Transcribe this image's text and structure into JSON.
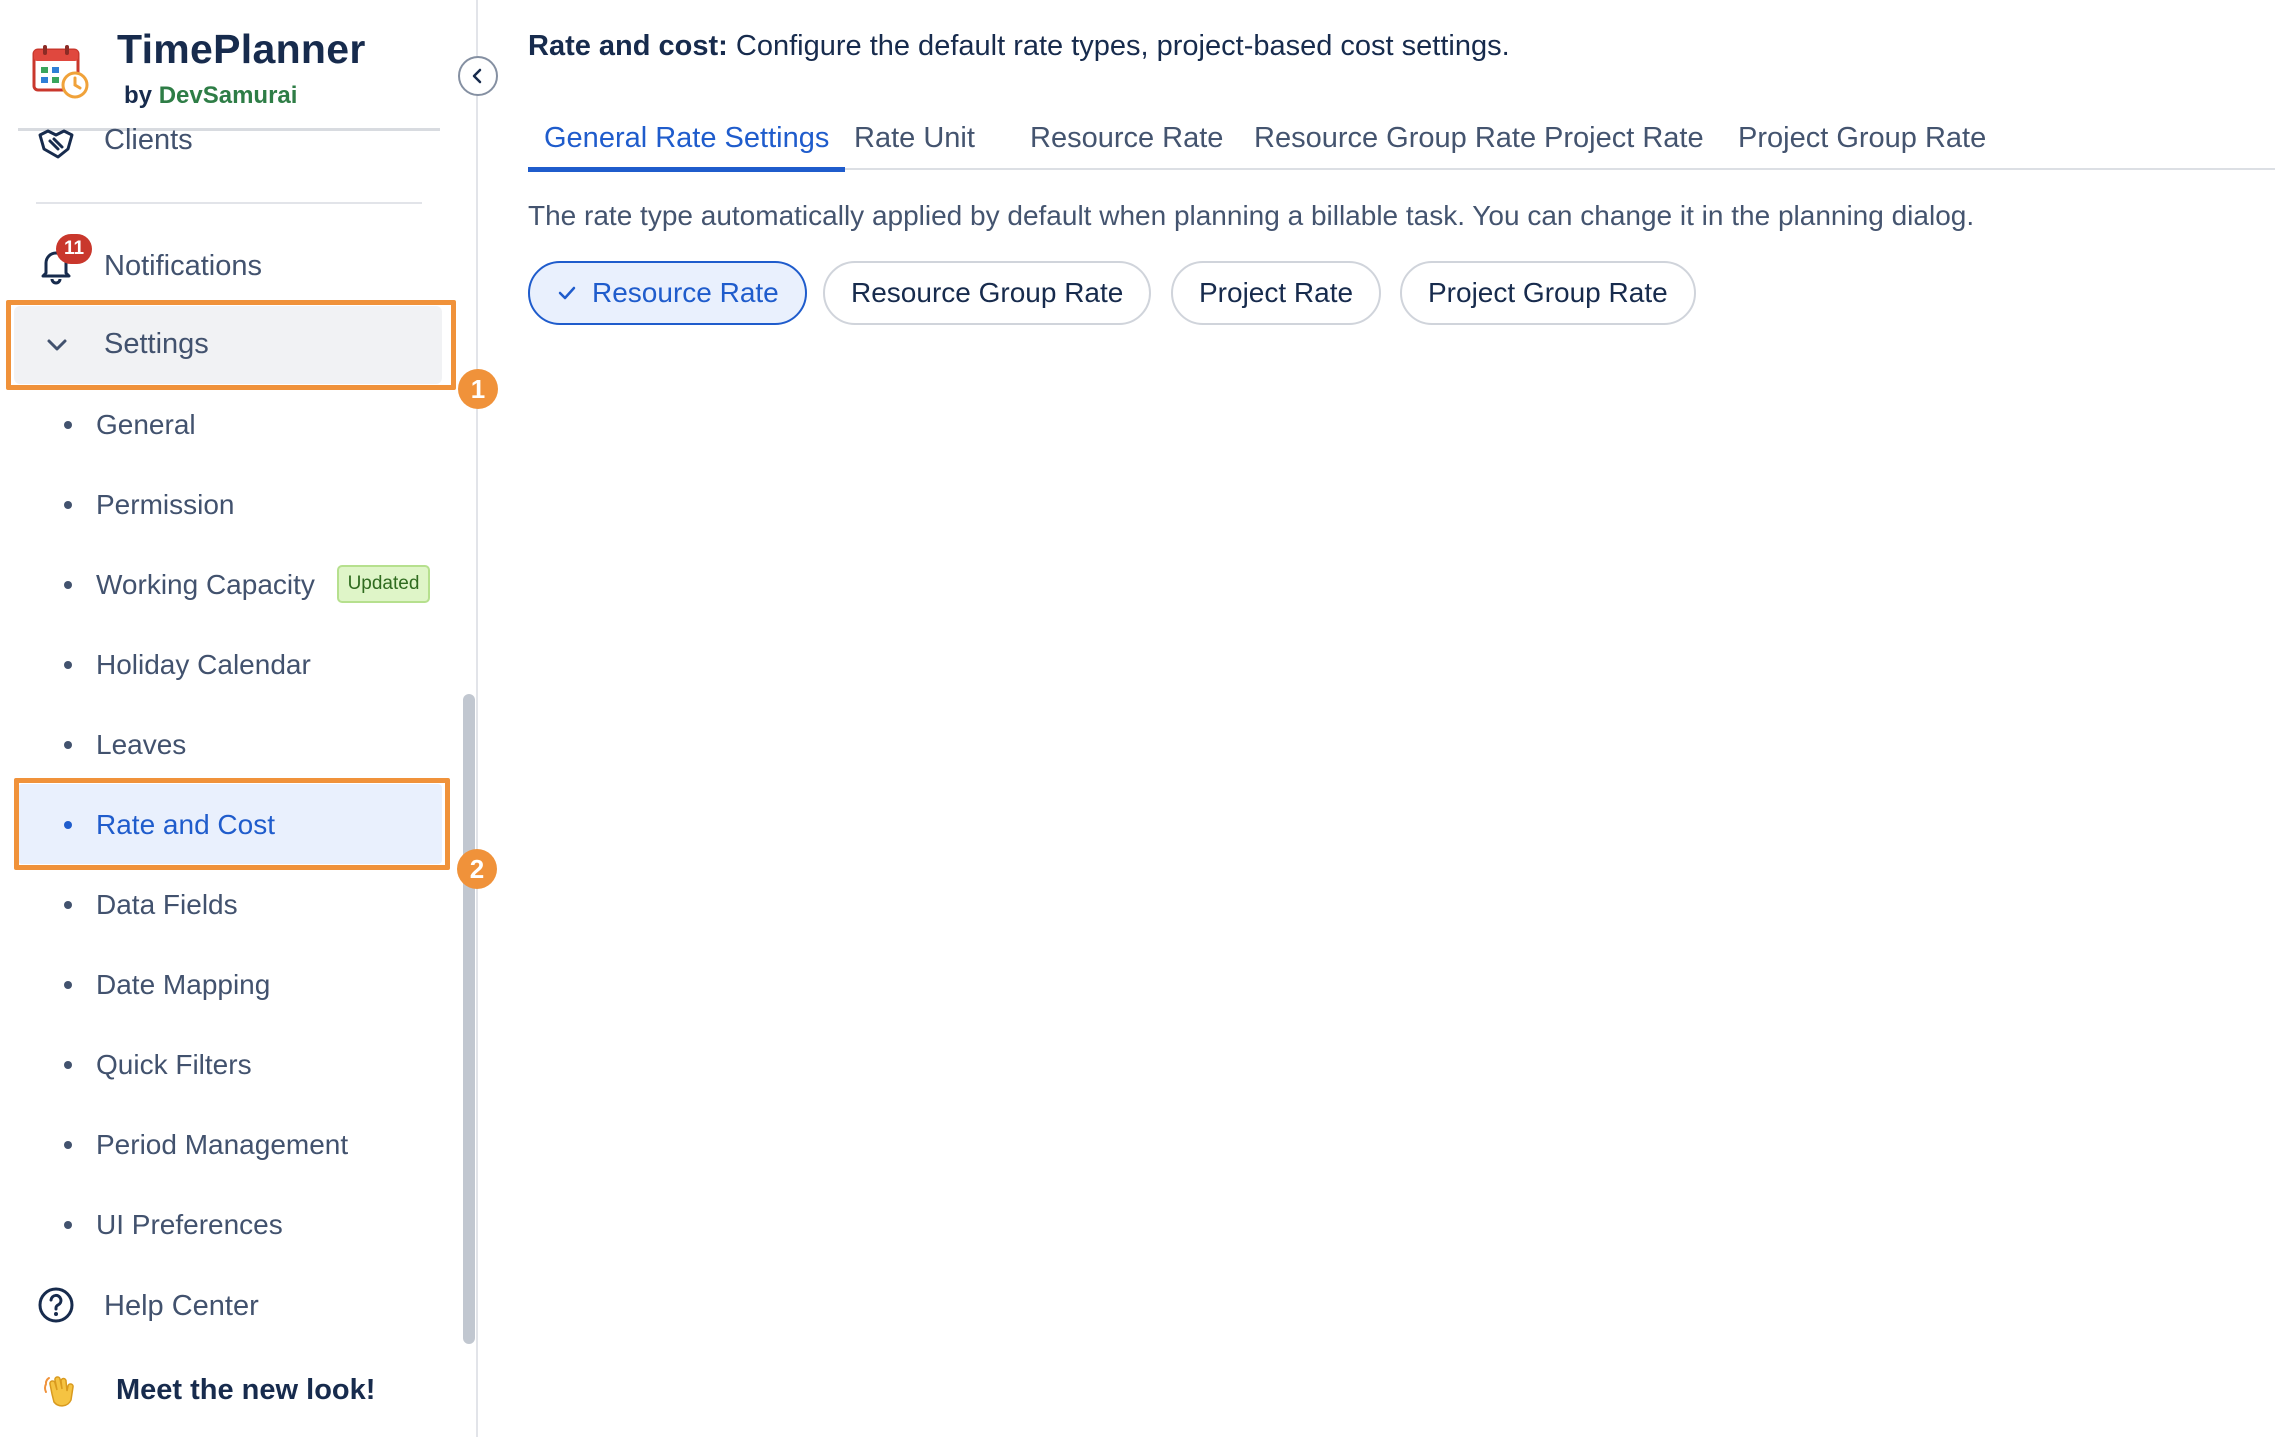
{
  "sidebar": {
    "brand": {
      "title": "TimePlanner",
      "by": "by",
      "company": "DevSamurai"
    },
    "clients": "Clients",
    "notifications": {
      "label": "Notifications",
      "count": "11"
    },
    "settings": "Settings",
    "submenu": [
      {
        "label": "General"
      },
      {
        "label": "Permission"
      },
      {
        "label": "Working Capacity",
        "badge": "Updated"
      },
      {
        "label": "Holiday Calendar"
      },
      {
        "label": "Leaves"
      },
      {
        "label": "Rate and Cost",
        "active": true
      },
      {
        "label": "Data Fields"
      },
      {
        "label": "Date Mapping"
      },
      {
        "label": "Quick Filters"
      },
      {
        "label": "Period Management"
      },
      {
        "label": "UI Preferences"
      }
    ],
    "help": "Help Center",
    "meet": "Meet the new look!"
  },
  "annotations": {
    "step1": "1",
    "step2": "2"
  },
  "main": {
    "heading": "Rate and cost:",
    "heading_desc": "Configure the default rate types, project-based cost settings.",
    "tabs": [
      {
        "label": "General Rate Settings",
        "active": true
      },
      {
        "label": "Rate Unit"
      },
      {
        "label": "Resource Rate"
      },
      {
        "label": "Resource Group Rate"
      },
      {
        "label": "Project Rate"
      },
      {
        "label": "Project Group Rate"
      }
    ],
    "rate_desc": "The rate type automatically applied by default when planning a billable task. You can change it in the planning dialog.",
    "rate_options": [
      {
        "label": "Resource Rate",
        "selected": true
      },
      {
        "label": "Resource Group Rate"
      },
      {
        "label": "Project Rate"
      },
      {
        "label": "Project Group Rate"
      }
    ]
  },
  "colors": {
    "accent": "#1f5ccc",
    "highlight": "#f0923a",
    "badge_red": "#c9372c",
    "updated_bg": "#dff5c8"
  }
}
